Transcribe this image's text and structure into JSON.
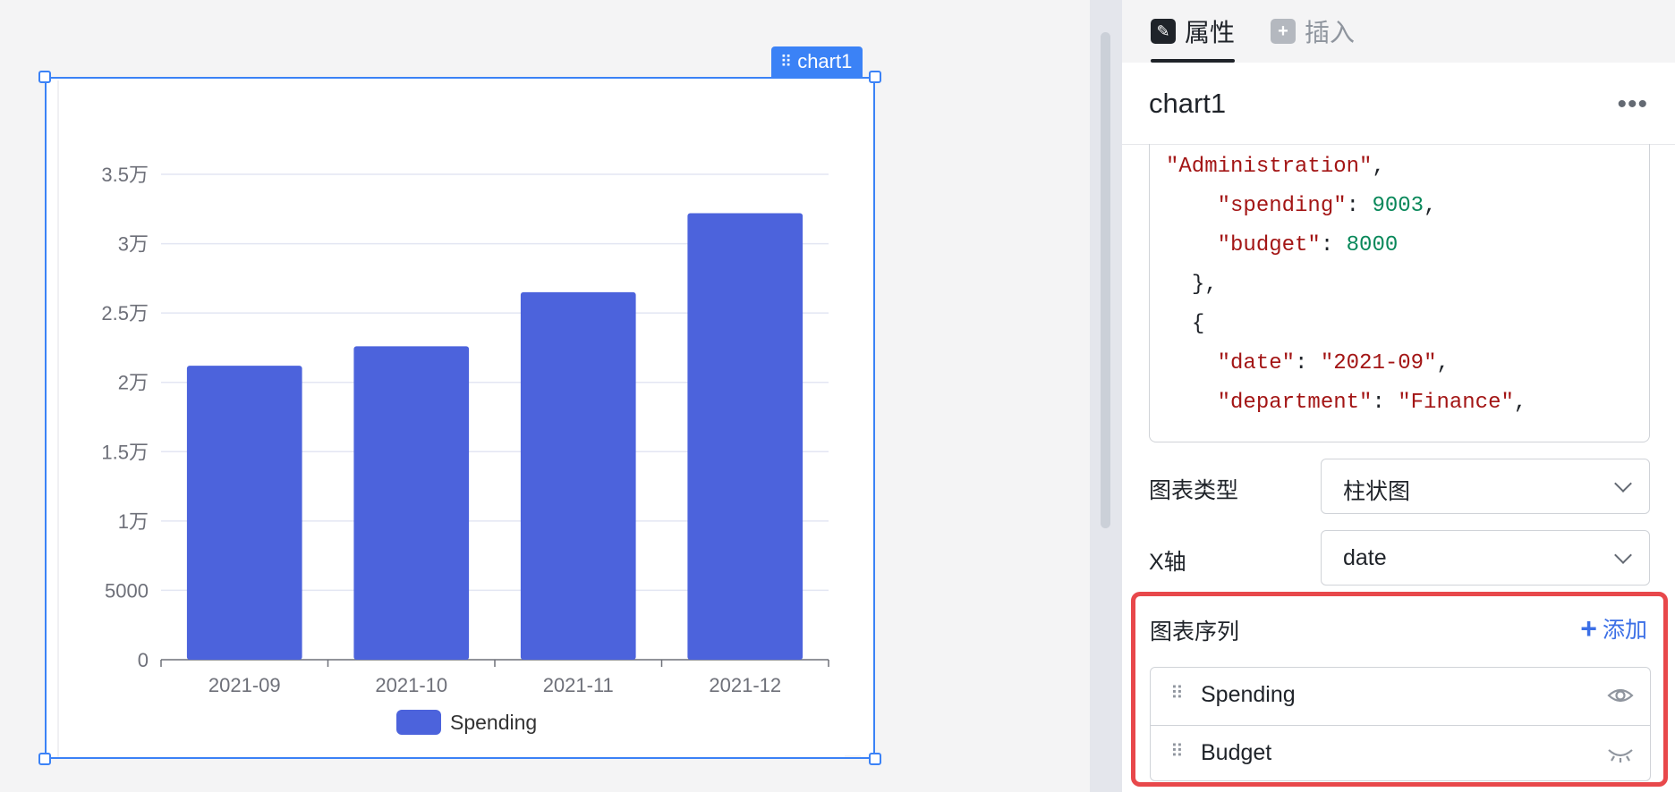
{
  "canvas": {
    "component_tag": "chart1"
  },
  "chart_data": {
    "type": "bar",
    "categories": [
      "2021-09",
      "2021-10",
      "2021-11",
      "2021-12"
    ],
    "series": [
      {
        "name": "Spending",
        "values": [
          21200,
          22600,
          26500,
          32200
        ],
        "color": "#4c63dc"
      }
    ],
    "y_ticks": [
      "0",
      "5000",
      "1万",
      "1.5万",
      "2万",
      "2.5万",
      "3万",
      "3.5万"
    ],
    "ylim": [
      0,
      35000
    ],
    "grid": true,
    "legend": "bottom-center",
    "title": "",
    "xlabel": "",
    "ylabel": ""
  },
  "panel": {
    "tabs": [
      {
        "label": "属性",
        "icon": "properties-icon",
        "active": true
      },
      {
        "label": "插入",
        "icon": "insert-icon",
        "active": false
      }
    ],
    "component_name": "chart1",
    "code_lines": [
      {
        "indent": "",
        "parts": [
          {
            "t": "\"Administration\"",
            "c": "str"
          },
          {
            "t": ",",
            "c": "plain"
          }
        ]
      },
      {
        "indent": "    ",
        "parts": [
          {
            "t": "\"spending\"",
            "c": "str"
          },
          {
            "t": ": ",
            "c": "plain"
          },
          {
            "t": "9003",
            "c": "num"
          },
          {
            "t": ",",
            "c": "plain"
          }
        ]
      },
      {
        "indent": "    ",
        "parts": [
          {
            "t": "\"budget\"",
            "c": "str"
          },
          {
            "t": ": ",
            "c": "plain"
          },
          {
            "t": "8000",
            "c": "num"
          }
        ]
      },
      {
        "indent": "  ",
        "parts": [
          {
            "t": "},",
            "c": "plain"
          }
        ]
      },
      {
        "indent": "  ",
        "parts": [
          {
            "t": "{",
            "c": "plain"
          }
        ]
      },
      {
        "indent": "    ",
        "parts": [
          {
            "t": "\"date\"",
            "c": "str"
          },
          {
            "t": ": ",
            "c": "plain"
          },
          {
            "t": "\"2021-09\"",
            "c": "str"
          },
          {
            "t": ",",
            "c": "plain"
          }
        ]
      },
      {
        "indent": "    ",
        "parts": [
          {
            "t": "\"department\"",
            "c": "str"
          },
          {
            "t": ": ",
            "c": "plain"
          },
          {
            "t": "\"Finance\"",
            "c": "str"
          },
          {
            "t": ",",
            "c": "plain"
          }
        ]
      }
    ],
    "chart_type": {
      "label": "图表类型",
      "value": "柱状图"
    },
    "x_axis": {
      "label": "X轴",
      "value": "date"
    },
    "series_section": {
      "title": "图表序列",
      "add_label": "添加",
      "items": [
        {
          "name": "Spending",
          "visible": true
        },
        {
          "name": "Budget",
          "visible": false
        }
      ]
    }
  }
}
